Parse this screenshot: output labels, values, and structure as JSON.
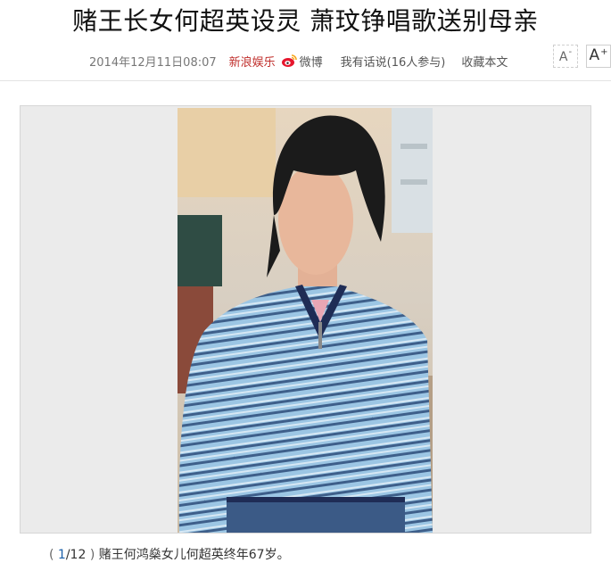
{
  "article": {
    "title": "赌王长女何超英设灵 萧玟铮唱歌送别母亲",
    "date": "2014年12月11日08:07",
    "source": "新浪娱乐",
    "weibo_label": "微博",
    "comments_label": "我有话说(16人参与)",
    "collect_label": "收藏本文",
    "font_decrease_label": "A",
    "font_decrease_sup": "-",
    "font_increase_label": "A",
    "font_increase_sup": "+"
  },
  "gallery": {
    "current": "1",
    "total": "/12",
    "caption": "赌王何鸿燊女儿何超英终年67岁。",
    "open_paren": "(",
    "close_paren": ")"
  },
  "colors": {
    "source": "#c0302d",
    "index": "#1a5fa8",
    "sweater": "#9cc6e4",
    "stripe": "#3e5f8a"
  }
}
